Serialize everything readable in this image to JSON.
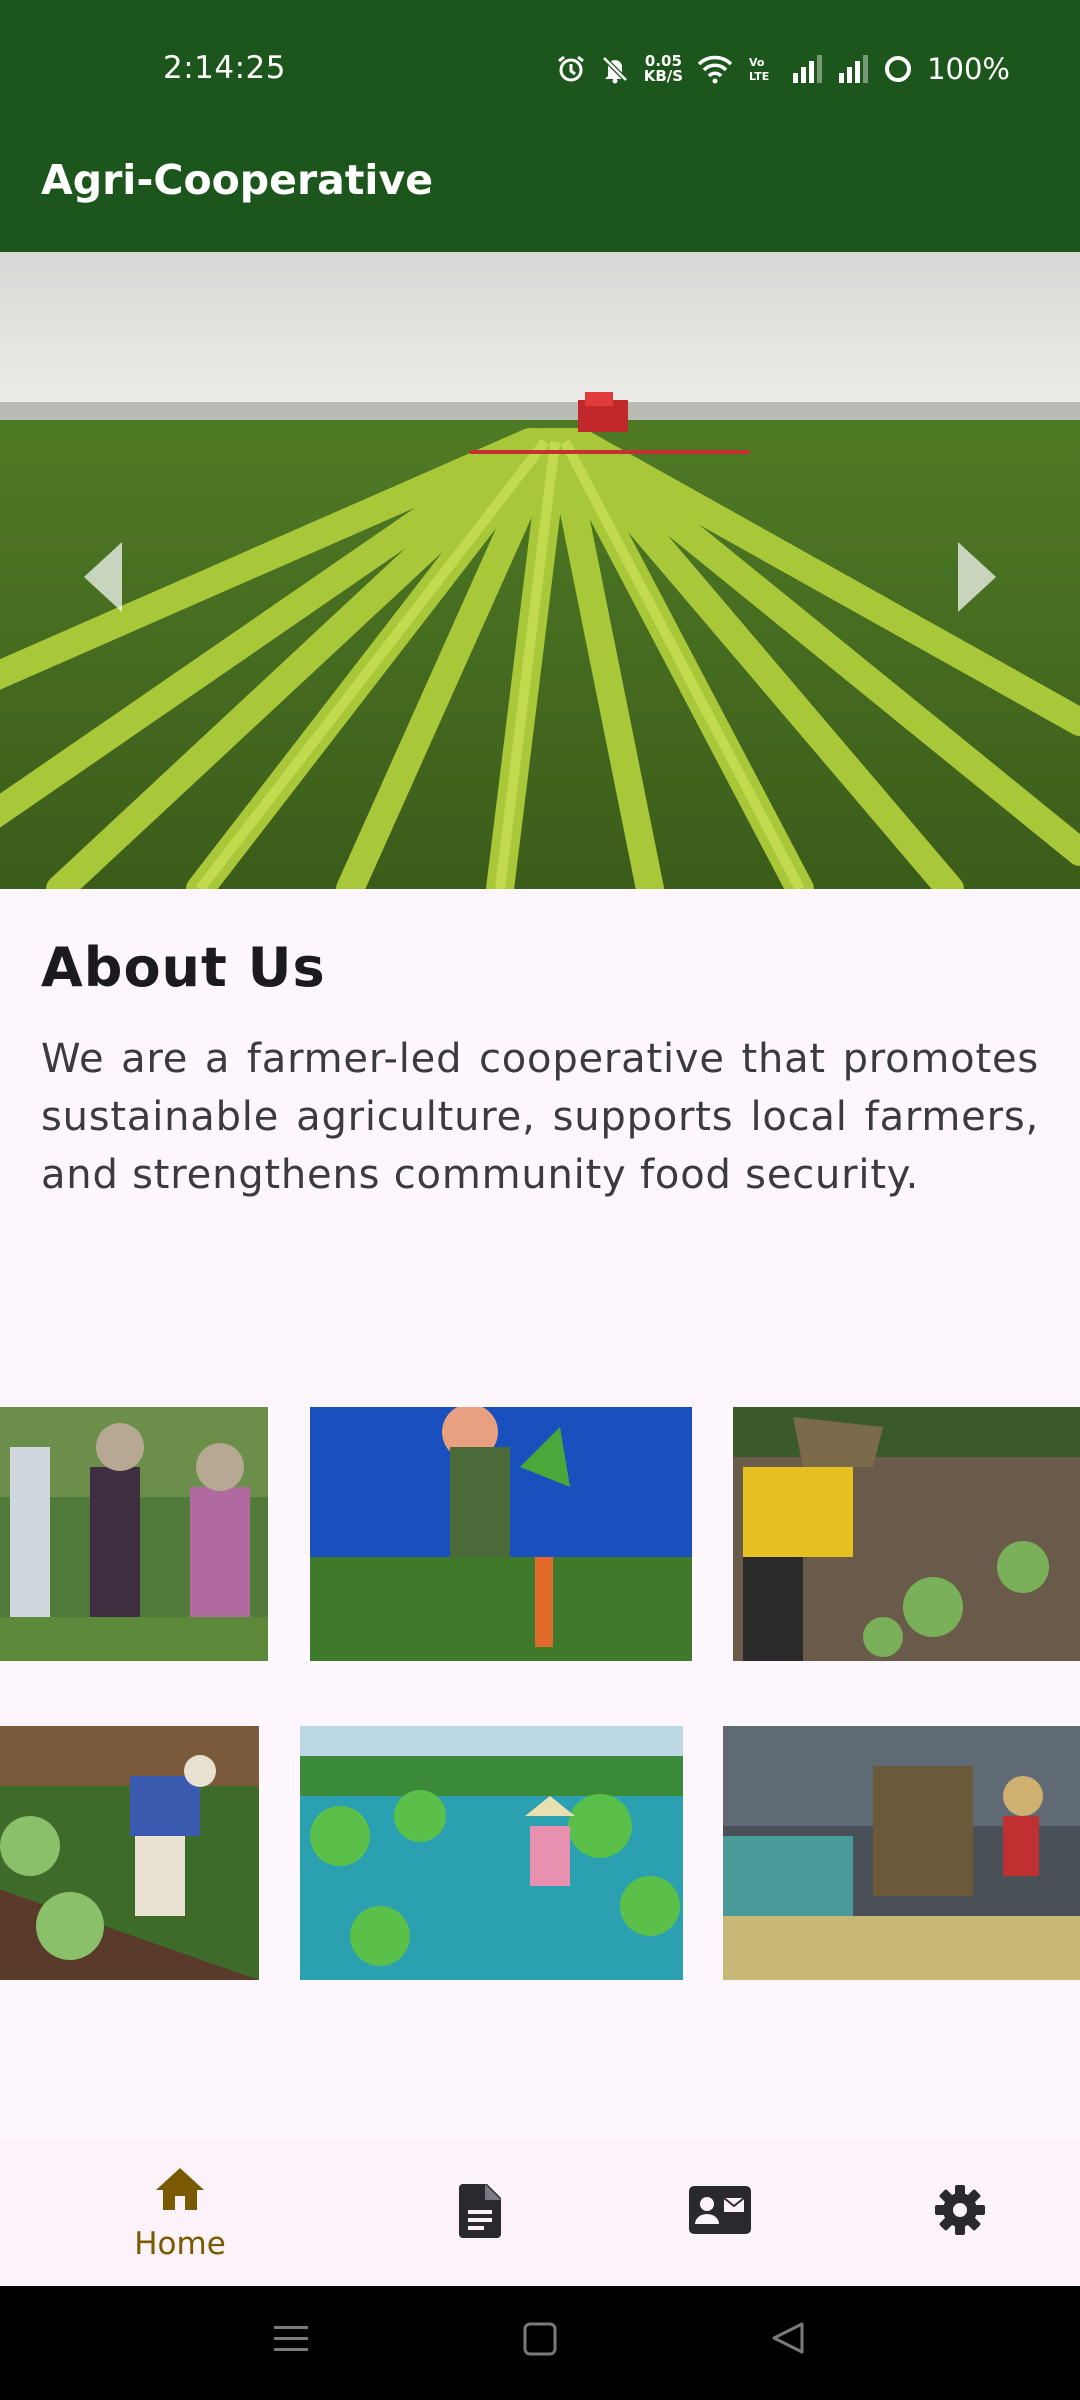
{
  "status_bar": {
    "time": "2:14:25",
    "net_speed_value": "0.05",
    "net_speed_unit": "KB/S",
    "battery": "100%"
  },
  "app_bar": {
    "title": "Agri-Cooperative"
  },
  "hero": {
    "image": "farmland-with-tractor"
  },
  "about": {
    "title": "About Us",
    "body": "We are a farmer-led cooperative that promotes sustainable agriculture, supports local farmers, and strengthens community food security."
  },
  "gallery": {
    "row1": [
      "farmers-harvesting-beans",
      "farmer-holding-carrots",
      "farmer-in-yellow-planting"
    ],
    "row2": [
      "farmer-tending-vegetables",
      "farmers-in-wet-field",
      "farmers-loading-truck"
    ]
  },
  "bottom_nav": {
    "items": [
      {
        "label": "Home",
        "icon": "home-icon",
        "active": true
      },
      {
        "icon": "document-icon"
      },
      {
        "icon": "contact-card-icon"
      },
      {
        "icon": "settings-icon"
      }
    ],
    "active_color": "#7a5a00"
  },
  "colors": {
    "primary": "#1d561c",
    "background": "#fdf7fd"
  }
}
